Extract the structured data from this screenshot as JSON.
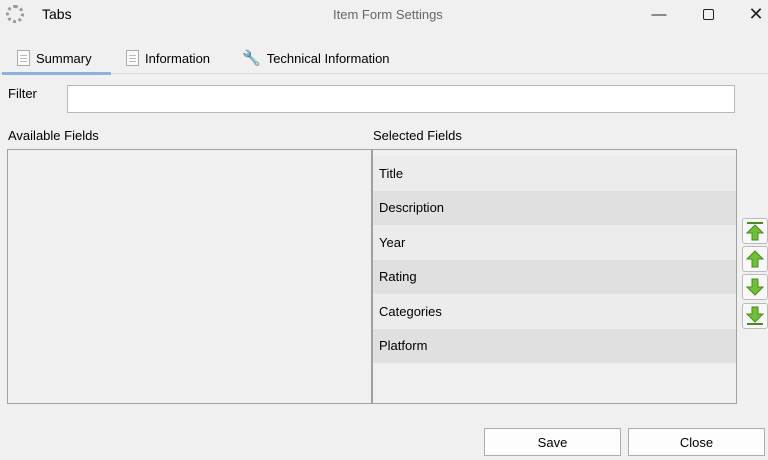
{
  "window": {
    "app_label": "Tabs",
    "title": "Item Form Settings"
  },
  "tabs": [
    {
      "label": "Summary"
    },
    {
      "label": "Information"
    },
    {
      "label": "Technical Information"
    }
  ],
  "filter": {
    "label": "Filter",
    "value": ""
  },
  "available": {
    "label": "Available Fields",
    "items": []
  },
  "selected": {
    "label": "Selected Fields",
    "items": [
      "Title",
      "Description",
      "Year",
      "Rating",
      "Categories",
      "Platform"
    ]
  },
  "buttons": {
    "save": "Save",
    "close": "Close"
  },
  "colors": {
    "accent": "#8ab4de",
    "arrow": "#5fae2e"
  }
}
